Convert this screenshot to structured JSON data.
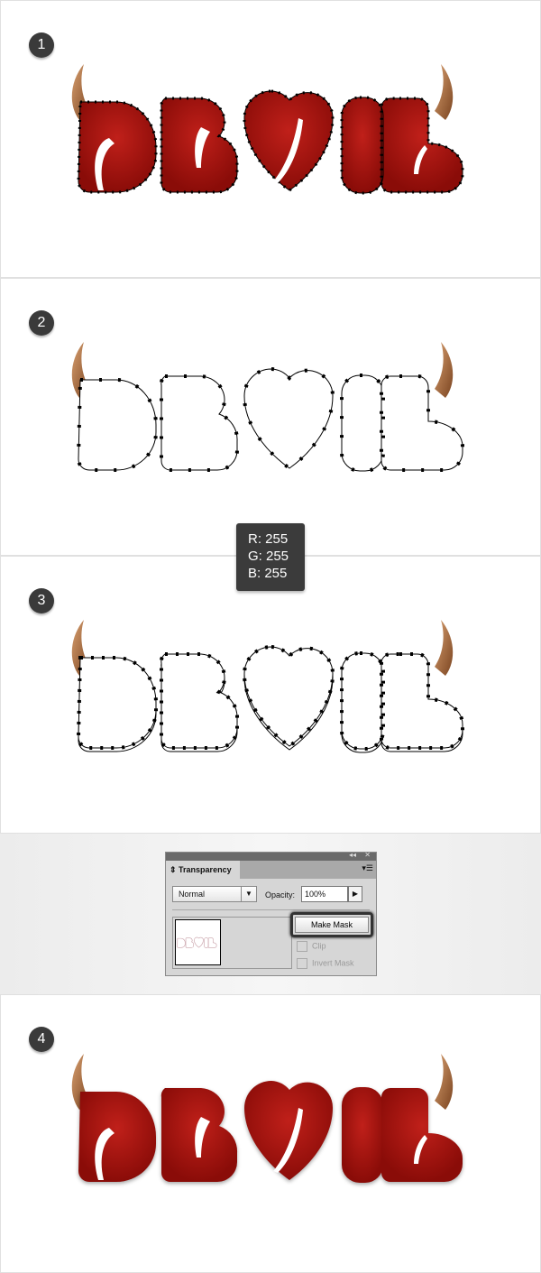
{
  "steps": [
    "1",
    "2",
    "3",
    "4"
  ],
  "tooltip": {
    "r": "R: 255",
    "g": "G: 255",
    "b": "B: 255"
  },
  "artwork_text": "DEVIL",
  "colors": {
    "letter_red": "#a3140f",
    "horn": "#a86a3c",
    "step_badge": "#3a3a3a"
  },
  "transparency_panel": {
    "title": "Transparency",
    "blend_mode": "Normal",
    "opacity_label": "Opacity:",
    "opacity_value": "100%",
    "make_mask_label": "Make Mask",
    "clip_label": "Clip",
    "invert_mask_label": "Invert Mask",
    "collapse_icon": "double-chevron-left-icon",
    "close_icon": "close-icon",
    "menu_icon": "panel-menu-icon"
  }
}
